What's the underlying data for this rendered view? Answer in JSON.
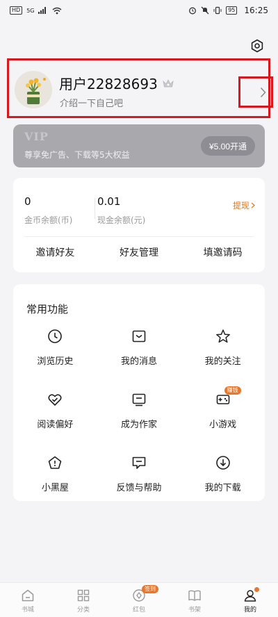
{
  "status_bar": {
    "left_badge": "HD",
    "signal": "5G",
    "battery": "95",
    "time": "16:25"
  },
  "profile": {
    "username": "用户22828693",
    "bio": "介绍一下自己吧"
  },
  "vip": {
    "title": "VIP",
    "subtitle": "尊享免广告、下载等5大权益",
    "button_label": "¥5.00开通"
  },
  "wallet": {
    "coins_value": "0",
    "coins_label": "金币余额(币)",
    "cash_value": "0.01",
    "cash_label": "现金余额(元)",
    "withdraw_label": "提现"
  },
  "friends": {
    "invite": "邀请好友",
    "manage": "好友管理",
    "fill_code": "填邀请码"
  },
  "features": {
    "title": "常用功能",
    "items": [
      {
        "label": "浏览历史",
        "icon": "clock-icon"
      },
      {
        "label": "我的消息",
        "icon": "message-icon"
      },
      {
        "label": "我的关注",
        "icon": "star-icon"
      },
      {
        "label": "阅读偏好",
        "icon": "heart-check-icon"
      },
      {
        "label": "成为作家",
        "icon": "writer-icon"
      },
      {
        "label": "小游戏",
        "icon": "gamepad-icon"
      },
      {
        "label": "小黑屋",
        "icon": "house-icon"
      },
      {
        "label": "反馈与帮助",
        "icon": "feedback-icon"
      },
      {
        "label": "我的下载",
        "icon": "download-icon"
      }
    ],
    "games_badge": "赚钱"
  },
  "tabbar": {
    "items": [
      {
        "label": "书城"
      },
      {
        "label": "分类"
      },
      {
        "label": "红包"
      },
      {
        "label": "书架"
      },
      {
        "label": "我的"
      }
    ],
    "redpacket_badge": "签到"
  },
  "colors": {
    "accent": "#e8772e",
    "highlight_box": "#d7191f",
    "vip_bg": "#a9a8ad"
  }
}
